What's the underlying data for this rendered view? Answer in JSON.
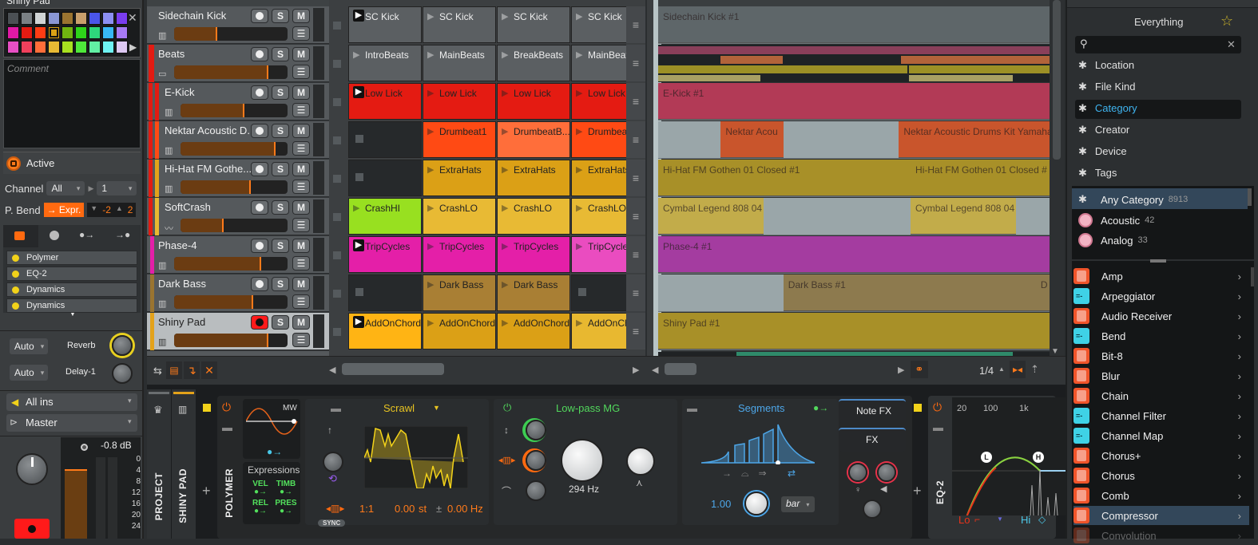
{
  "inspector": {
    "title": "Shiny Pad",
    "palette": [
      "#4b5054",
      "#7a8084",
      "#d0d4d5",
      "#8a97d4",
      "#9a7430",
      "#c9a06c",
      "#4a55ea",
      "#8c8ff2",
      "#7a3df0",
      "#e019a6",
      "#e41b12",
      "#ff3c14",
      "#d9a015",
      "#70b410",
      "#2ed41a",
      "#2ed87c",
      "#38b8f5",
      "#a77af5",
      "#e74fc4",
      "#f0405c",
      "#ff6e3a",
      "#e8ba34",
      "#a8e020",
      "#4ee83a",
      "#62f0a4",
      "#6ff2f2",
      "#ddc8f2"
    ],
    "comment_placeholder": "Comment",
    "active_label": "Active",
    "channel_label": "Channel",
    "channel_value": "All",
    "channel_number": "1",
    "pbend_label": "P. Bend",
    "pbend_value": "→ Expr.",
    "pbend_down": "-2",
    "pbend_up": "2",
    "device_chain": [
      "Polymer",
      "EQ-2",
      "Dynamics",
      "Dynamics"
    ],
    "sends": [
      {
        "mode": "Auto",
        "name": "Reverb"
      },
      {
        "mode": "Auto",
        "name": "Delay-1"
      }
    ],
    "input": "All ins",
    "output": "Master",
    "level_db": "-0.8 dB",
    "meter_scale": [
      "0",
      "4",
      "8",
      "12",
      "16",
      "20",
      "24"
    ],
    "fader_level": 0.9
  },
  "tracks": [
    {
      "name": "Sidechain Kick",
      "color": "",
      "volume": 0.38,
      "icon": "piano",
      "arm": false
    },
    {
      "name": "Beats",
      "color": "#e21b12",
      "volume": 0.83,
      "icon": "folder",
      "arm": false
    },
    {
      "name": "E-Kick",
      "color": "#e21b12",
      "volume": 0.6,
      "icon": "piano",
      "arm": false
    },
    {
      "name": "Nektar Acoustic D...",
      "color": "#ff4a14",
      "volume": 0.89,
      "icon": "piano",
      "arm": false
    },
    {
      "name": "Hi-Hat FM Gothe...",
      "color": "#e3a21a",
      "volume": 0.66,
      "icon": "piano",
      "arm": false
    },
    {
      "name": "SoftCrash",
      "color": "#e8b830",
      "volume": 0.4,
      "icon": "wave",
      "arm": false
    },
    {
      "name": "Phase-4",
      "color": "#e41fa8",
      "volume": 0.77,
      "icon": "piano",
      "arm": false
    },
    {
      "name": "Dark Bass",
      "color": "#9a7430",
      "volume": 0.7,
      "icon": "piano",
      "arm": false
    },
    {
      "name": "Shiny Pad",
      "color": "#e3a21a",
      "volume": 0.83,
      "icon": "piano",
      "arm": true
    }
  ],
  "launcher": {
    "rows": [
      {
        "clips": [
          {
            "name": "SC Kick",
            "color": "#5b5f62",
            "play": true
          },
          {
            "name": "SC Kick",
            "color": "#5b5f62"
          },
          {
            "name": "SC Kick",
            "color": "#5b5f62"
          },
          {
            "name": "SC Kick",
            "color": "#5b5f62"
          }
        ]
      },
      {
        "clips": [
          {
            "name": "IntroBeats",
            "color": "#5b5f62"
          },
          {
            "name": "MainBeats",
            "color": "#5b5f62"
          },
          {
            "name": "BreakBeats",
            "color": "#5b5f62"
          },
          {
            "name": "MainBeats",
            "color": "#5b5f62"
          }
        ]
      },
      {
        "clips": [
          {
            "name": "Low Lick",
            "color": "#e41b12",
            "play": true
          },
          {
            "name": "Low Lick",
            "color": "#e41b12"
          },
          {
            "name": "Low Lick",
            "color": "#e41b12"
          },
          {
            "name": "Low Lick",
            "color": "#e41b12"
          }
        ]
      },
      {
        "clips": [
          null,
          {
            "name": "Drumbeat1",
            "color": "#ff4a14"
          },
          {
            "name": "DrumbeatB...",
            "color": "#ff6e3a"
          },
          {
            "name": "Drumbeat",
            "color": "#ff4a14"
          }
        ]
      },
      {
        "clips": [
          null,
          {
            "name": "ExtraHats",
            "color": "#dba016"
          },
          {
            "name": "ExtraHats",
            "color": "#dba016"
          },
          {
            "name": "ExtraHats",
            "color": "#dba016"
          }
        ]
      },
      {
        "clips": [
          {
            "name": "CrashHI",
            "color": "#98e020"
          },
          {
            "name": "CrashLO",
            "color": "#e8ba34"
          },
          {
            "name": "CrashLO",
            "color": "#e8ba34"
          },
          {
            "name": "CrashLO",
            "color": "#e8ba34"
          }
        ]
      },
      {
        "clips": [
          {
            "name": "TripCycles",
            "color": "#e41fa8",
            "play": true
          },
          {
            "name": "TripCycles",
            "color": "#e41fa8"
          },
          {
            "name": "TripCycles",
            "color": "#e41fa8"
          },
          {
            "name": "TripCycles",
            "color": "#ea4cc0"
          }
        ]
      },
      {
        "clips": [
          null,
          {
            "name": "Dark Bass",
            "color": "#a97f34"
          },
          {
            "name": "Dark Bass",
            "color": "#a97f34"
          },
          null
        ]
      },
      {
        "clips": [
          {
            "name": "AddOnChord",
            "color": "#ffb414",
            "play": true
          },
          {
            "name": "AddOnChord",
            "color": "#dba016"
          },
          {
            "name": "AddOnChord",
            "color": "#dba016"
          },
          {
            "name": "AddOnChord",
            "color": "#e8b830"
          }
        ]
      }
    ]
  },
  "arranger": {
    "clips": [
      {
        "row": 0,
        "name": "Sidechain Kick #1",
        "start": 0,
        "end": 1,
        "color": "#5e6669"
      },
      {
        "row": 2,
        "name": "E-Kick #1",
        "start": 0,
        "end": 1,
        "color": "#b23a56"
      },
      {
        "row": 3,
        "name": "Nektar Acou",
        "start": 0.16,
        "end": 0.32,
        "color": "#c9552c"
      },
      {
        "row": 3,
        "name": "Nektar Acoustic Drums Kit Yamaha",
        "start": 0.615,
        "end": 1,
        "color": "#c9552c"
      },
      {
        "row": 4,
        "name": "Hi-Hat FM Gothen 01 Closed #1",
        "start": 0,
        "end": 0.645,
        "color": "#a89028"
      },
      {
        "row": 4,
        "name": "Hi-Hat FM Gothen 01 Closed #",
        "start": 0.645,
        "end": 1,
        "color": "#a89028"
      },
      {
        "row": 5,
        "name": "Cymbal Legend 808 04",
        "start": 0,
        "end": 0.27,
        "color": "#c2ac4a"
      },
      {
        "row": 5,
        "name": "Cymbal Legend 808 04",
        "start": 0.645,
        "end": 0.915,
        "color": "#c2ac4a"
      },
      {
        "row": 6,
        "name": "Phase-4 #1",
        "start": 0,
        "end": 1,
        "color": "#a43ca0"
      },
      {
        "row": 7,
        "name": "Dark Bass #1",
        "start": 0.32,
        "end": 0.965,
        "color": "#8d7a4e"
      },
      {
        "row": 7,
        "name": "D",
        "start": 0.965,
        "end": 1,
        "color": "#8d7a4e"
      },
      {
        "row": 8,
        "name": "Shiny Pad #1",
        "start": 0,
        "end": 1,
        "color": "#a89028"
      }
    ],
    "grid_quantize": "1/4"
  },
  "browser": {
    "title": "Everything",
    "search_placeholder": "",
    "filters": [
      "Location",
      "File Kind",
      "Category",
      "Creator",
      "Device",
      "Tags"
    ],
    "selected_filter": "Category",
    "categories": [
      {
        "name": "Any Category",
        "count": "8913"
      },
      {
        "name": "Acoustic",
        "count": "42"
      },
      {
        "name": "Analog",
        "count": "33"
      }
    ],
    "devices": [
      {
        "name": "Amp",
        "kind": "red"
      },
      {
        "name": "Arpeggiator",
        "kind": "cyan"
      },
      {
        "name": "Audio Receiver",
        "kind": "red"
      },
      {
        "name": "Bend",
        "kind": "cyan"
      },
      {
        "name": "Bit-8",
        "kind": "red"
      },
      {
        "name": "Blur",
        "kind": "red"
      },
      {
        "name": "Chain",
        "kind": "red"
      },
      {
        "name": "Channel Filter",
        "kind": "cyan"
      },
      {
        "name": "Channel Map",
        "kind": "cyan"
      },
      {
        "name": "Chorus+",
        "kind": "red"
      },
      {
        "name": "Chorus",
        "kind": "red"
      },
      {
        "name": "Comb",
        "kind": "red"
      },
      {
        "name": "Compressor",
        "kind": "red"
      },
      {
        "name": "Convolution",
        "kind": "red"
      }
    ],
    "selected_device": "Compressor"
  },
  "devices": {
    "tabs": [
      "PROJECT",
      "SHINY PAD"
    ],
    "polymer": {
      "name": "POLYMER",
      "lfo_label": "MW",
      "expressions_title": "Expressions",
      "expressions": [
        "VEL",
        "TIMB",
        "REL",
        "PRES"
      ],
      "osc_preset": "Scrawl",
      "ratio": "1:1",
      "pitch": "0.00",
      "pitch_unit": "st",
      "fine": "0.00 Hz",
      "sync_label": "SYNC",
      "filter_preset": "Low-pass MG",
      "cutoff": "294 Hz",
      "env_preset": "Segments",
      "env_value": "1.00",
      "env_unit": "bar",
      "note_fx": "Note FX",
      "fx": "FX"
    },
    "eq2": {
      "name": "EQ-2",
      "freq_labels": [
        "20",
        "100",
        "1k"
      ],
      "low_label": "Lo",
      "high_label": "Hi",
      "low_node": "L",
      "high_node": "H"
    }
  }
}
